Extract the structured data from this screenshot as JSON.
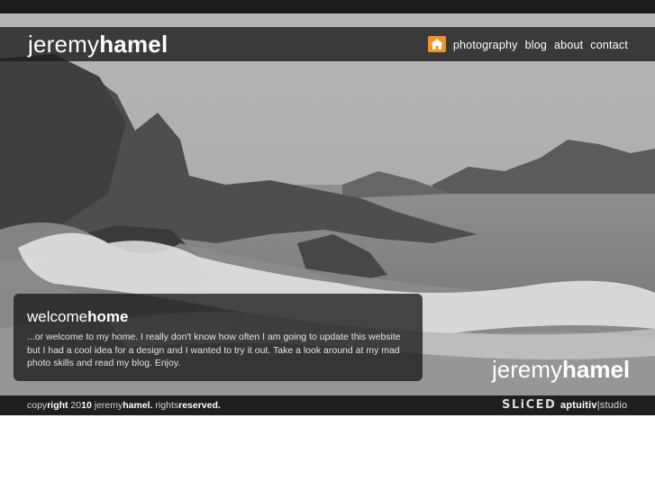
{
  "site": {
    "logo_light": "jeremy",
    "logo_bold": "hamel"
  },
  "nav": {
    "home_icon": "home-icon",
    "items": [
      {
        "label": "photography"
      },
      {
        "label": "blog"
      },
      {
        "label": "about"
      },
      {
        "label": "contact"
      }
    ]
  },
  "welcome": {
    "title_light": "welcome",
    "title_bold": "home",
    "body": "...or welcome to my home. I really don't know how often I am going to update this website but I had a cool idea for a design and I wanted to try it out. Take a look around at my mad photo skills and read my blog. Enjoy."
  },
  "watermark": {
    "light": "jeremy",
    "bold": "hamel"
  },
  "footer": {
    "copy_a": "copy",
    "copy_b": "right",
    "year_a": " 20",
    "year_b": "10",
    "name_a": " jeremy",
    "name_b": "hamel.",
    "rights_a": " rights",
    "rights_b": "reserved.",
    "sliced": "SLiCED",
    "aptuitiv_a": "aptuitiv",
    "aptuitiv_b": "|studio"
  },
  "colors": {
    "home_icon_bg": "#f29422",
    "bar_bg": "#1f1f1f"
  }
}
